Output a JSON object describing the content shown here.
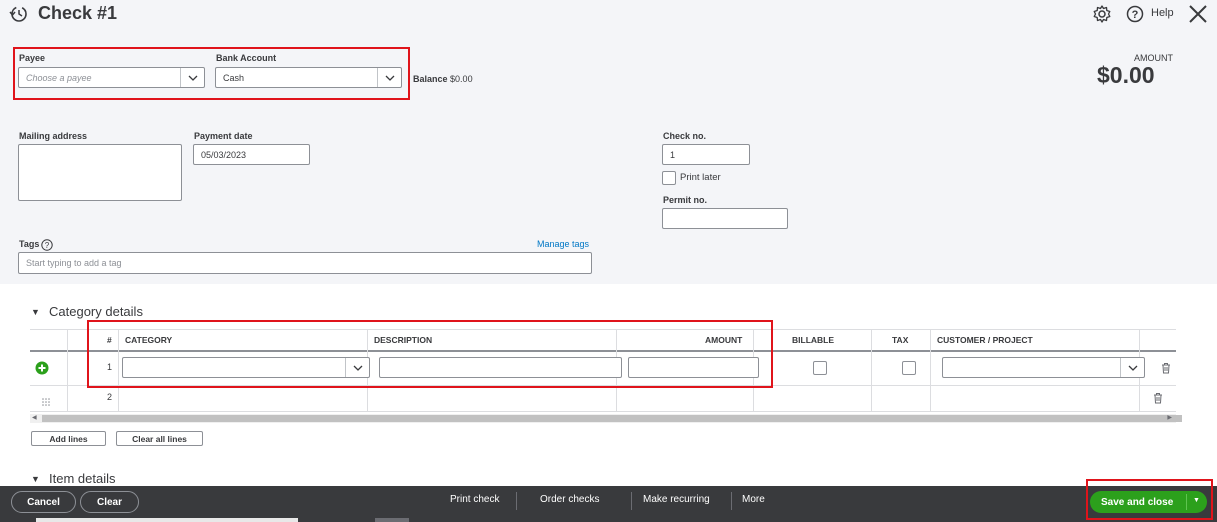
{
  "header": {
    "title": "Check #1",
    "help_label": "Help"
  },
  "form": {
    "payee": {
      "label": "Payee",
      "placeholder": "Choose a payee"
    },
    "bank_account": {
      "label": "Bank Account",
      "value": "Cash"
    },
    "balance": {
      "label": "Balance",
      "value": "$0.00"
    },
    "amount": {
      "label": "AMOUNT",
      "value": "$0.00"
    },
    "mailing_address": {
      "label": "Mailing address"
    },
    "payment_date": {
      "label": "Payment date",
      "value": "05/03/2023"
    },
    "check_no": {
      "label": "Check no.",
      "value": "1"
    },
    "print_later": {
      "label": "Print later"
    },
    "permit_no": {
      "label": "Permit no."
    },
    "tags": {
      "label": "Tags",
      "placeholder": "Start typing to add a tag",
      "manage_label": "Manage tags"
    }
  },
  "category_details": {
    "title": "Category details",
    "columns": {
      "num": "#",
      "category": "CATEGORY",
      "description": "DESCRIPTION",
      "amount": "AMOUNT",
      "billable": "BILLABLE",
      "tax": "TAX",
      "customer": "CUSTOMER / PROJECT"
    },
    "rows": [
      {
        "num": "1"
      },
      {
        "num": "2"
      }
    ],
    "add_lines_label": "Add lines",
    "clear_lines_label": "Clear all lines"
  },
  "item_details": {
    "title": "Item details"
  },
  "footer": {
    "cancel_label": "Cancel",
    "clear_label": "Clear",
    "print_check_label": "Print check",
    "order_checks_label": "Order checks",
    "make_recurring_label": "Make recurring",
    "more_label": "More",
    "save_close_label": "Save and close"
  },
  "colors": {
    "green": "#2ca01c",
    "dark": "#393a3d",
    "link": "#0077c5",
    "highlight": "#e0141b"
  }
}
